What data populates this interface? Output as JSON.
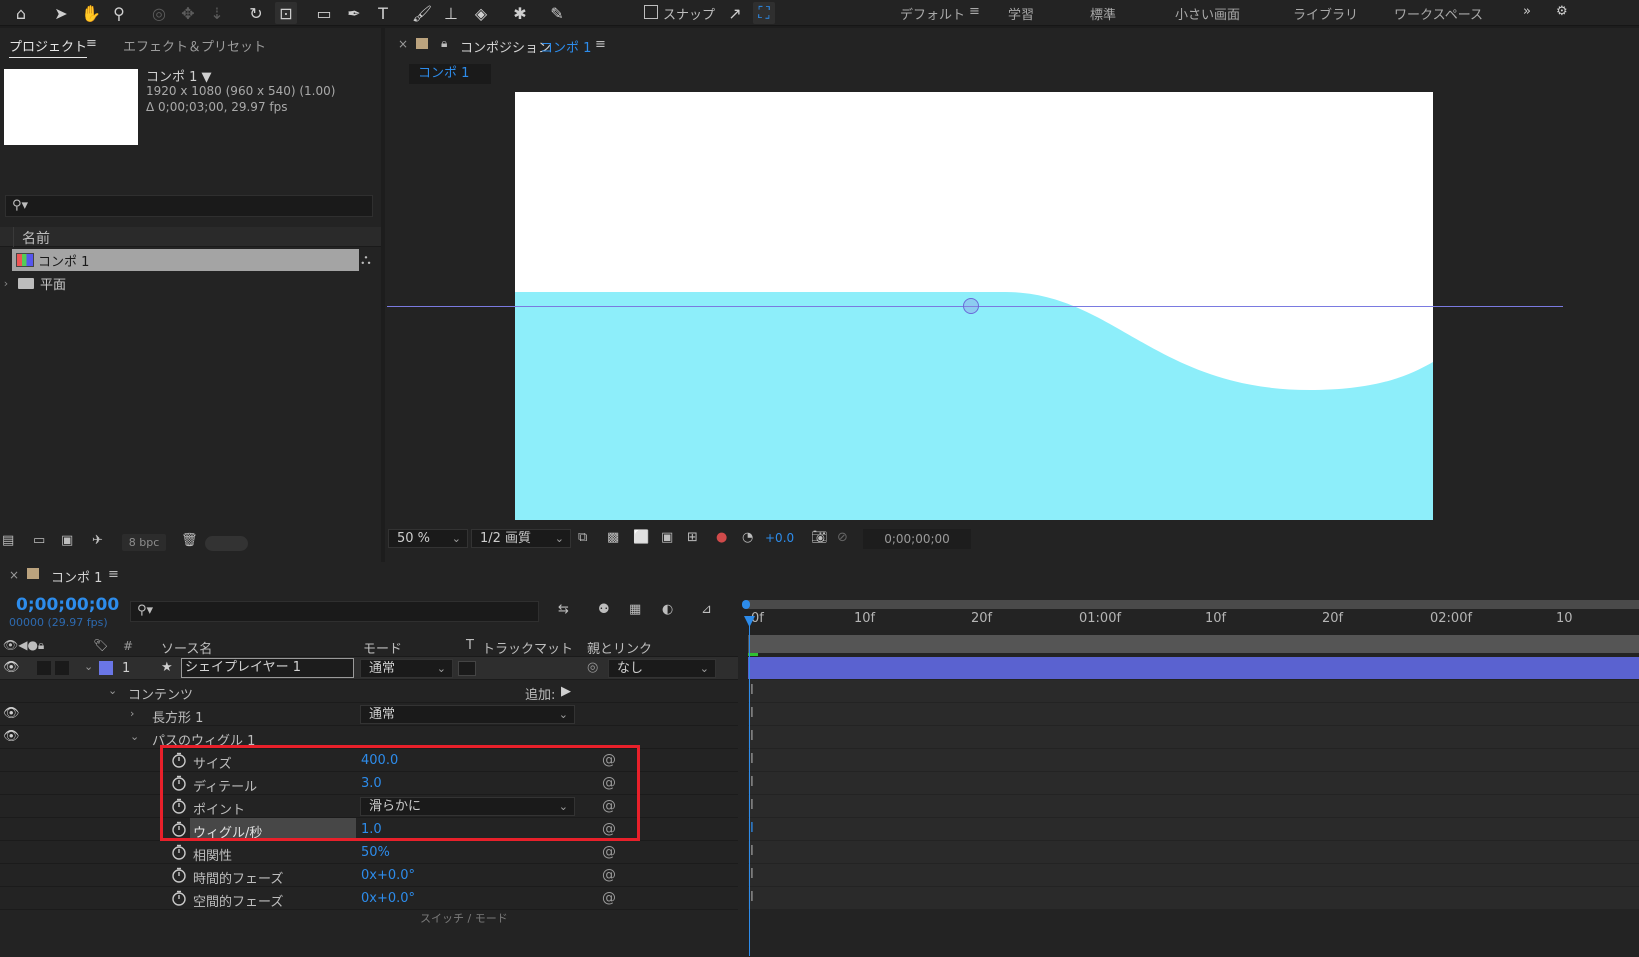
{
  "toolbar": {
    "snap_label": "スナップ",
    "workspaces": [
      "デフォルト",
      "学習",
      "標準",
      "小さい画面",
      "ライブラリ",
      "ワークスペース"
    ],
    "active_workspace": "デフォルト",
    "overflow": "»"
  },
  "project": {
    "tab_project": "プロジェクト",
    "tab_effects": "エフェクト＆プリセット",
    "comp_name": "コンポ 1 ▼",
    "comp_dims": "1920 x 1080  (960 x 540) (1.00)",
    "comp_duration": "Δ 0;00;03;00, 29.97 fps",
    "column_name": "名前",
    "items": [
      {
        "label": "コンポ 1",
        "icon": "composition-icon",
        "selected": true
      },
      {
        "label": "平面",
        "icon": "folder-icon",
        "selected": false
      }
    ],
    "bpc": "8 bpc"
  },
  "viewer": {
    "tab_prefix": "コンポジション",
    "tab_comp": "コンポ 1",
    "flow_tab": "コンポ 1",
    "zoom": "50 %",
    "quality": "1/2 画質",
    "exposure": "+0.0",
    "timecode": "0;00;00;00",
    "canvas_fill": "#8deefa"
  },
  "timeline": {
    "tab_label": "コンポ 1",
    "timecode": "0;00;00;00",
    "frames": "00000 (29.97 fps)",
    "columns": {
      "source": "ソース名",
      "mode": "モード",
      "t": "T",
      "trackmatte": "トラックマット",
      "parent": "親とリンク"
    },
    "ruler": [
      "0f",
      "10f",
      "20f",
      "01:00f",
      "10f",
      "20f",
      "02:00f",
      "10"
    ],
    "layer": {
      "num": "1",
      "name": "シェイプレイヤー 1",
      "mode": "通常",
      "parent": "なし"
    },
    "contents_label": "コンテンツ",
    "add_label": "追加:",
    "rect_label": "長方形 1",
    "rect_mode": "通常",
    "wiggle_label": "パスのウィグル 1",
    "props": [
      {
        "name": "サイズ",
        "value": "400.0"
      },
      {
        "name": "ディテール",
        "value": "3.0"
      },
      {
        "name": "ポイント",
        "value": "滑らかに"
      },
      {
        "name": "ウィグル/秒",
        "value": "1.0"
      },
      {
        "name": "相関性",
        "value": "50%"
      },
      {
        "name": "時間的フェーズ",
        "value": "0x+0.0°"
      },
      {
        "name": "空間的フェーズ",
        "value": "0x+0.0°"
      }
    ],
    "bottom_hint": "スイッチ / モード"
  }
}
